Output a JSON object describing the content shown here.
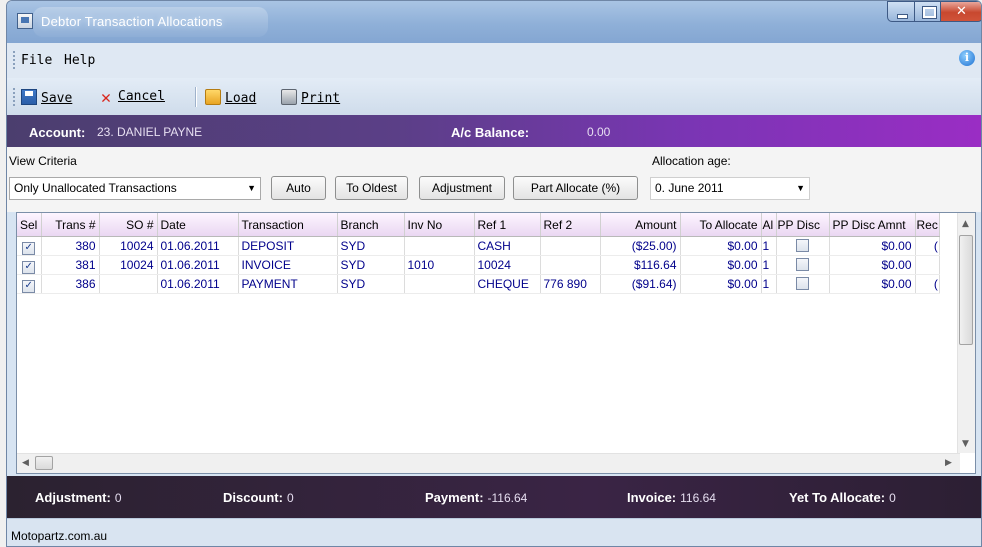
{
  "window": {
    "title": "Debtor Transaction Allocations"
  },
  "menu": {
    "items": [
      "File",
      "Help"
    ]
  },
  "toolbar": {
    "save": "Save",
    "cancel": "Cancel",
    "load": "Load",
    "print": "Print"
  },
  "account": {
    "label": "Account:",
    "value": "23. DANIEL PAYNE",
    "balance_label": "A/c Balance:",
    "balance_value": "0.00"
  },
  "criteria": {
    "view_label": "View Criteria",
    "view_selected": "Only Unallocated Transactions",
    "age_label": "Allocation age:",
    "age_selected": "0. June 2011",
    "buttons": {
      "auto": "Auto",
      "to_oldest": "To Oldest",
      "adjustment": "Adjustment",
      "part_allocate": "Part Allocate (%)"
    }
  },
  "grid": {
    "columns": [
      "Sel",
      "Trans #",
      "SO #",
      "Date",
      "Transaction",
      "Branch",
      "Inv No",
      "Ref 1",
      "Ref 2",
      "Amount",
      "To Allocate",
      "Al",
      "PP Disc",
      "PP Disc Amnt",
      "Rec"
    ],
    "rows": [
      {
        "sel": true,
        "trans": "380",
        "so": "10024",
        "date": "01.06.2011",
        "transaction": "DEPOSIT",
        "branch": "SYD",
        "inv": "",
        "ref1": "CASH",
        "ref2": "",
        "amount": "($25.00)",
        "to_allocate": "$0.00",
        "al": "1",
        "pp_disc": false,
        "pp_disc_amnt": "$0.00",
        "rec": "("
      },
      {
        "sel": true,
        "trans": "381",
        "so": "10024",
        "date": "01.06.2011",
        "transaction": "INVOICE",
        "branch": "SYD",
        "inv": "1010",
        "ref1": "10024",
        "ref2": "",
        "amount": "$116.64",
        "to_allocate": "$0.00",
        "al": "1",
        "pp_disc": false,
        "pp_disc_amnt": "$0.00",
        "rec": ""
      },
      {
        "sel": true,
        "trans": "386",
        "so": "",
        "date": "01.06.2011",
        "transaction": "PAYMENT",
        "branch": "SYD",
        "inv": "",
        "ref1": "CHEQUE",
        "ref2": "776 890",
        "amount": "($91.64)",
        "to_allocate": "$0.00",
        "al": "1",
        "pp_disc": false,
        "pp_disc_amnt": "$0.00",
        "rec": "("
      }
    ]
  },
  "summary": {
    "adjustment_label": "Adjustment:",
    "adjustment_value": "0",
    "discount_label": "Discount:",
    "discount_value": "0",
    "payment_label": "Payment:",
    "payment_value": "-116.64",
    "invoice_label": "Invoice:",
    "invoice_value": "116.64",
    "yet_label": "Yet To Allocate:",
    "yet_value": "0"
  },
  "status": {
    "text": "Motopartz.com.au"
  }
}
